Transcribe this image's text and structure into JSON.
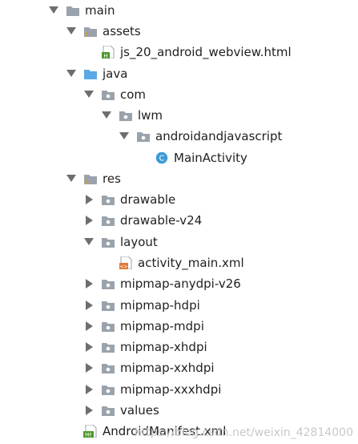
{
  "tree": {
    "main": "main",
    "assets": "assets",
    "html_file": "js_20_android_webview.html",
    "java": "java",
    "com": "com",
    "lwm": "lwm",
    "package": "androidandjavascript",
    "main_activity": "MainActivity",
    "res": "res",
    "drawable": "drawable",
    "drawable_v24": "drawable-v24",
    "layout": "layout",
    "activity_main": "activity_main.xml",
    "mipmap_anydpi": "mipmap-anydpi-v26",
    "mipmap_hdpi": "mipmap-hdpi",
    "mipmap_mdpi": "mipmap-mdpi",
    "mipmap_xhdpi": "mipmap-xhdpi",
    "mipmap_xxhdpi": "mipmap-xxhdpi",
    "mipmap_xxxhdpi": "mipmap-xxxhdpi",
    "values": "values",
    "manifest": "AndroidManifest.xml"
  },
  "icons": {
    "html_badge": "H",
    "class_badge": "C",
    "manifest_badge": "MF",
    "layout_badge": "<>"
  },
  "colors": {
    "folder_gray": "#9aa3ab",
    "folder_blue": "#5aa9e6",
    "class_blue": "#3d9ad6",
    "html_green": "#4c9a2a",
    "layout_orange": "#e07b39"
  },
  "watermark": "https://blog.csdn.net/weixin_42814000"
}
